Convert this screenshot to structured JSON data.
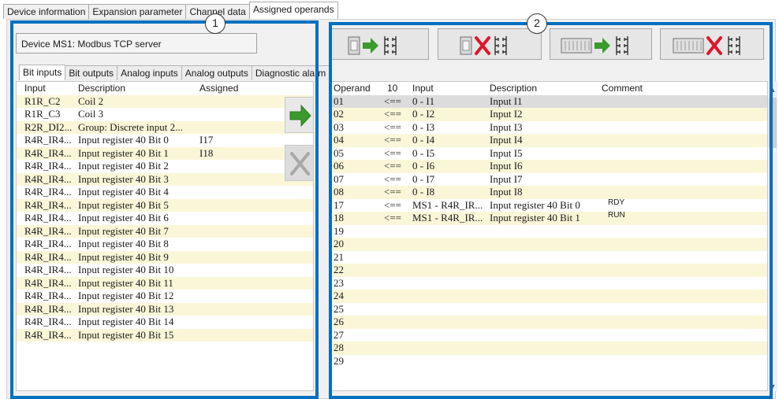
{
  "top_tabs": [
    "Device information",
    "Expansion parameter",
    "Channel data",
    "Assigned operands"
  ],
  "device_label": "Device MS1: Modbus TCP server",
  "sub_tabs": [
    "Bit inputs",
    "Bit outputs",
    "Analog inputs",
    "Analog outputs",
    "Diagnostic alarm"
  ],
  "left_table": {
    "headers": [
      "Input",
      "Description",
      "Assigned"
    ],
    "rows": [
      {
        "input": "R1R_C2",
        "desc": "Coil 2",
        "assigned": "",
        "selected": true
      },
      {
        "input": "R1R_C3",
        "desc": "Coil 3",
        "assigned": ""
      },
      {
        "input": "R2R_DI2...",
        "desc": "Group: Discrete input 2...",
        "assigned": ""
      },
      {
        "input": "R4R_IR4...",
        "desc": "Input register 40 Bit 0",
        "assigned": "I17"
      },
      {
        "input": "R4R_IR4...",
        "desc": "Input register 40 Bit 1",
        "assigned": "I18"
      },
      {
        "input": "R4R_IR4...",
        "desc": "Input register 40 Bit 2",
        "assigned": ""
      },
      {
        "input": "R4R_IR4...",
        "desc": "Input register 40 Bit 3",
        "assigned": ""
      },
      {
        "input": "R4R_IR4...",
        "desc": "Input register 40 Bit 4",
        "assigned": ""
      },
      {
        "input": "R4R_IR4...",
        "desc": "Input register 40 Bit 5",
        "assigned": ""
      },
      {
        "input": "R4R_IR4...",
        "desc": "Input register 40 Bit 6",
        "assigned": ""
      },
      {
        "input": "R4R_IR4...",
        "desc": "Input register 40 Bit 7",
        "assigned": ""
      },
      {
        "input": "R4R_IR4...",
        "desc": "Input register 40 Bit 8",
        "assigned": ""
      },
      {
        "input": "R4R_IR4...",
        "desc": "Input register 40 Bit 9",
        "assigned": ""
      },
      {
        "input": "R4R_IR4...",
        "desc": "Input register 40 Bit 10",
        "assigned": ""
      },
      {
        "input": "R4R_IR4...",
        "desc": "Input register 40 Bit 11",
        "assigned": ""
      },
      {
        "input": "R4R_IR4...",
        "desc": "Input register 40 Bit 12",
        "assigned": ""
      },
      {
        "input": "R4R_IR4...",
        "desc": "Input register 40 Bit 13",
        "assigned": ""
      },
      {
        "input": "R4R_IR4...",
        "desc": "Input register 40 Bit 14",
        "assigned": ""
      },
      {
        "input": "R4R_IR4...",
        "desc": "Input register 40 Bit 15",
        "assigned": ""
      }
    ]
  },
  "right_table": {
    "headers": [
      "Operand",
      "10",
      "Input",
      "Description",
      "Comment"
    ],
    "rows": [
      {
        "operand": "01",
        "arrow": "<==",
        "input": "0 - I1",
        "desc": "Input I1",
        "comment": "",
        "selected": true
      },
      {
        "operand": "02",
        "arrow": "<==",
        "input": "0 - I2",
        "desc": "Input I2",
        "comment": ""
      },
      {
        "operand": "03",
        "arrow": "<==",
        "input": "0 - I3",
        "desc": "Input I3",
        "comment": ""
      },
      {
        "operand": "04",
        "arrow": "<==",
        "input": "0 - I4",
        "desc": "Input I4",
        "comment": ""
      },
      {
        "operand": "05",
        "arrow": "<==",
        "input": "0 - I5",
        "desc": "Input I5",
        "comment": ""
      },
      {
        "operand": "06",
        "arrow": "<==",
        "input": "0 - I6",
        "desc": "Input I6",
        "comment": ""
      },
      {
        "operand": "07",
        "arrow": "<==",
        "input": "0 - I7",
        "desc": "Input I7",
        "comment": ""
      },
      {
        "operand": "08",
        "arrow": "<==",
        "input": "0 - I8",
        "desc": "Input I8",
        "comment": ""
      },
      {
        "operand": "17",
        "arrow": "<==",
        "input": "MS1 - R4R_IR...",
        "desc": "Input register 40 Bit 0",
        "comment": "RDY"
      },
      {
        "operand": "18",
        "arrow": "<==",
        "input": "MS1 - R4R_IR...",
        "desc": "Input register 40 Bit 1",
        "comment": "RUN"
      },
      {
        "operand": "19",
        "arrow": "",
        "input": "",
        "desc": "",
        "comment": ""
      },
      {
        "operand": "20",
        "arrow": "",
        "input": "",
        "desc": "",
        "comment": ""
      },
      {
        "operand": "21",
        "arrow": "",
        "input": "",
        "desc": "",
        "comment": ""
      },
      {
        "operand": "22",
        "arrow": "",
        "input": "",
        "desc": "",
        "comment": ""
      },
      {
        "operand": "23",
        "arrow": "",
        "input": "",
        "desc": "",
        "comment": ""
      },
      {
        "operand": "24",
        "arrow": "",
        "input": "",
        "desc": "",
        "comment": ""
      },
      {
        "operand": "25",
        "arrow": "",
        "input": "",
        "desc": "",
        "comment": ""
      },
      {
        "operand": "26",
        "arrow": "",
        "input": "",
        "desc": "",
        "comment": ""
      },
      {
        "operand": "27",
        "arrow": "",
        "input": "",
        "desc": "",
        "comment": ""
      },
      {
        "operand": "28",
        "arrow": "",
        "input": "",
        "desc": "",
        "comment": ""
      },
      {
        "operand": "29",
        "arrow": "",
        "input": "",
        "desc": "",
        "comment": ""
      }
    ]
  },
  "toolbar_icons": [
    "assign-one-icon",
    "remove-one-icon",
    "assign-all-icon",
    "remove-all-icon"
  ],
  "callouts": [
    "1",
    "2"
  ],
  "colors": {
    "frame": "#0070c0",
    "arrow_green": "#3a9a2c",
    "cross_red": "#e0152a",
    "row_yellow": "#fbf6d8",
    "row_selected": "#dcdcdc"
  }
}
